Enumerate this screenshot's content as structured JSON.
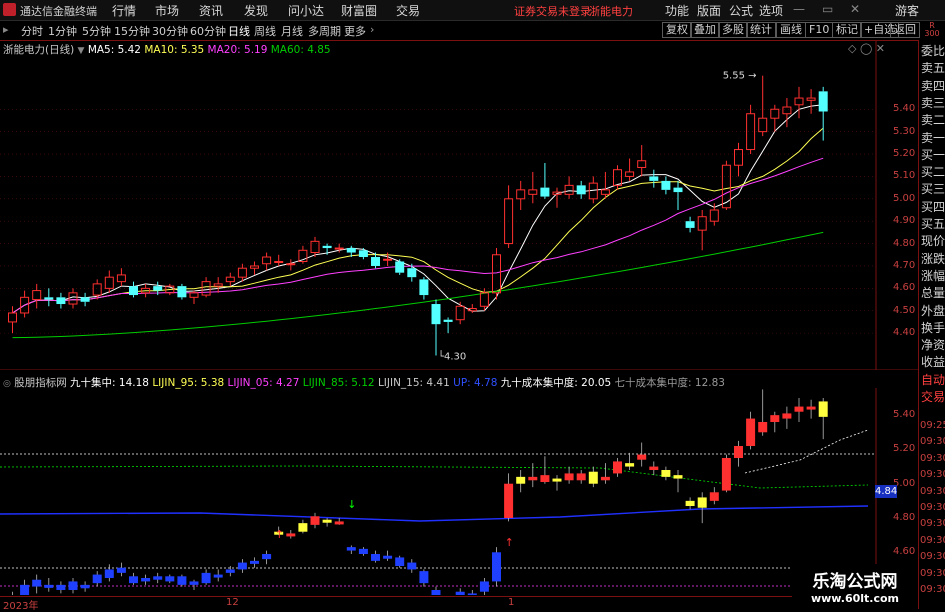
{
  "app": {
    "title": "通达信金融终端"
  },
  "menu": {
    "items": [
      "行情",
      "市场",
      "资讯",
      "发现",
      "问小达",
      "财富圈",
      "交易"
    ],
    "alert": "证券交易未登录",
    "stock_name": "浙能电力",
    "right_items": [
      "功能",
      "版面",
      "公式",
      "选项"
    ],
    "guest": "游客"
  },
  "toolbar": {
    "periods": [
      "分时",
      "1分钟",
      "5分钟",
      "15分钟",
      "30分钟",
      "60分钟",
      "日线",
      "周线",
      "月线",
      "多周期",
      "更多"
    ],
    "active_period": "日线",
    "right_buttons": [
      "复权",
      "叠加",
      "多股",
      "统计",
      "画线",
      "F10",
      "标记",
      "+自选",
      "返回"
    ]
  },
  "main_legend": {
    "title": "浙能电力(日线)",
    "ma5": "MA5: 5.42",
    "ma10": "MA10: 5.35",
    "ma20": "MA20: 5.19",
    "ma60": "MA60: 4.85",
    "high_label": "5.55",
    "low_label": "4.30"
  },
  "sub_legend": {
    "name": "股朋指标网",
    "jz90": "九十集中: 14.18",
    "lj95": "LIJIN_95: 5.38",
    "lj05": "LIJIN_05: 4.27",
    "lj85": "LIJIN_85: 5.12",
    "lj15": "LIJIN_15: 4.41",
    "up": "UP: 4.78",
    "cb90": "九十成本集中度: 20.05",
    "cb70": "七十成本集中度: 12.83"
  },
  "price_axis": [
    "5.40",
    "5.30",
    "5.20",
    "5.10",
    "5.00",
    "4.90",
    "4.80",
    "4.70",
    "4.60",
    "4.50",
    "4.40"
  ],
  "sub_axis": [
    "5.40",
    "5.20",
    "5.00",
    "4.80",
    "4.60"
  ],
  "sub_marker": "4.84",
  "sub_times": [
    "09:25",
    "09:30",
    "09:30",
    "09:30",
    "09:30",
    "09:30",
    "09:30",
    "09:30",
    "09:30",
    "09:30",
    "09:30"
  ],
  "date_axis": [
    "2023年",
    "12",
    "1"
  ],
  "right_column": [
    "委比",
    "卖五",
    "卖四",
    "卖三",
    "卖二",
    "卖一",
    "买一",
    "买二",
    "买三",
    "买四",
    "买五",
    "现价",
    "涨跌",
    "涨幅",
    "总量",
    "外盘",
    "换手",
    "净资",
    "收益",
    "自动",
    "交易"
  ],
  "corner": {
    "r": "R",
    "num": "300"
  },
  "watermark": {
    "line1": "乐淘公式网",
    "line2": "www.60lt.com"
  },
  "colors": {
    "up": "#ff3030",
    "down": "#54ffff",
    "ma5": "#ffffff",
    "ma10": "#ffff55",
    "ma20": "#ff40ff",
    "ma60": "#00cc00"
  },
  "chart_data": {
    "type": "candlestick",
    "title": "浙能电力(日线)",
    "candles": [
      {
        "o": 4.45,
        "h": 4.52,
        "l": 4.4,
        "c": 4.49
      },
      {
        "o": 4.49,
        "h": 4.59,
        "l": 4.47,
        "c": 4.56
      },
      {
        "o": 4.55,
        "h": 4.62,
        "l": 4.51,
        "c": 4.59
      },
      {
        "o": 4.56,
        "h": 4.6,
        "l": 4.52,
        "c": 4.55
      },
      {
        "o": 4.56,
        "h": 4.58,
        "l": 4.51,
        "c": 4.53
      },
      {
        "o": 4.53,
        "h": 4.6,
        "l": 4.51,
        "c": 4.58
      },
      {
        "o": 4.56,
        "h": 4.58,
        "l": 4.52,
        "c": 4.54
      },
      {
        "o": 4.57,
        "h": 4.64,
        "l": 4.55,
        "c": 4.62
      },
      {
        "o": 4.6,
        "h": 4.68,
        "l": 4.58,
        "c": 4.65
      },
      {
        "o": 4.63,
        "h": 4.69,
        "l": 4.61,
        "c": 4.66
      },
      {
        "o": 4.61,
        "h": 4.63,
        "l": 4.56,
        "c": 4.57
      },
      {
        "o": 4.58,
        "h": 4.62,
        "l": 4.56,
        "c": 4.6
      },
      {
        "o": 4.61,
        "h": 4.63,
        "l": 4.57,
        "c": 4.59
      },
      {
        "o": 4.58,
        "h": 4.62,
        "l": 4.57,
        "c": 4.61
      },
      {
        "o": 4.61,
        "h": 4.62,
        "l": 4.55,
        "c": 4.56
      },
      {
        "o": 4.56,
        "h": 4.59,
        "l": 4.53,
        "c": 4.58
      },
      {
        "o": 4.57,
        "h": 4.65,
        "l": 4.56,
        "c": 4.63
      },
      {
        "o": 4.61,
        "h": 4.65,
        "l": 4.58,
        "c": 4.62
      },
      {
        "o": 4.63,
        "h": 4.67,
        "l": 4.61,
        "c": 4.65
      },
      {
        "o": 4.65,
        "h": 4.71,
        "l": 4.63,
        "c": 4.69
      },
      {
        "o": 4.69,
        "h": 4.72,
        "l": 4.66,
        "c": 4.7
      },
      {
        "o": 4.71,
        "h": 4.76,
        "l": 4.68,
        "c": 4.74
      },
      {
        "o": 4.72,
        "h": 4.75,
        "l": 4.7,
        "c": 4.72
      },
      {
        "o": 4.71,
        "h": 4.73,
        "l": 4.68,
        "c": 4.71
      },
      {
        "o": 4.72,
        "h": 4.79,
        "l": 4.71,
        "c": 4.77
      },
      {
        "o": 4.76,
        "h": 4.83,
        "l": 4.74,
        "c": 4.81
      },
      {
        "o": 4.79,
        "h": 4.8,
        "l": 4.75,
        "c": 4.78
      },
      {
        "o": 4.78,
        "h": 4.8,
        "l": 4.76,
        "c": 4.78
      },
      {
        "o": 4.78,
        "h": 4.79,
        "l": 4.74,
        "c": 4.76
      },
      {
        "o": 4.77,
        "h": 4.78,
        "l": 4.73,
        "c": 4.74
      },
      {
        "o": 4.74,
        "h": 4.76,
        "l": 4.69,
        "c": 4.7
      },
      {
        "o": 4.73,
        "h": 4.76,
        "l": 4.7,
        "c": 4.73
      },
      {
        "o": 4.72,
        "h": 4.73,
        "l": 4.66,
        "c": 4.67
      },
      {
        "o": 4.69,
        "h": 4.71,
        "l": 4.63,
        "c": 4.65
      },
      {
        "o": 4.64,
        "h": 4.65,
        "l": 4.55,
        "c": 4.57
      },
      {
        "o": 4.53,
        "h": 4.55,
        "l": 4.3,
        "c": 4.44
      },
      {
        "o": 4.46,
        "h": 4.47,
        "l": 4.4,
        "c": 4.45
      },
      {
        "o": 4.46,
        "h": 4.54,
        "l": 4.44,
        "c": 4.52
      },
      {
        "o": 4.5,
        "h": 4.53,
        "l": 4.49,
        "c": 4.51
      },
      {
        "o": 4.52,
        "h": 4.6,
        "l": 4.5,
        "c": 4.58
      },
      {
        "o": 4.58,
        "h": 4.78,
        "l": 4.55,
        "c": 4.75
      },
      {
        "o": 4.8,
        "h": 5.06,
        "l": 4.78,
        "c": 5.0
      },
      {
        "o": 5.0,
        "h": 5.08,
        "l": 4.95,
        "c": 5.04
      },
      {
        "o": 5.02,
        "h": 5.12,
        "l": 4.98,
        "c": 5.04
      },
      {
        "o": 5.05,
        "h": 5.16,
        "l": 5.0,
        "c": 5.01
      },
      {
        "o": 5.02,
        "h": 5.05,
        "l": 4.96,
        "c": 5.03
      },
      {
        "o": 5.02,
        "h": 5.1,
        "l": 5.0,
        "c": 5.06
      },
      {
        "o": 5.06,
        "h": 5.08,
        "l": 5.0,
        "c": 5.02
      },
      {
        "o": 5.0,
        "h": 5.1,
        "l": 4.98,
        "c": 5.07
      },
      {
        "o": 5.02,
        "h": 5.12,
        "l": 5.0,
        "c": 5.04
      },
      {
        "o": 5.06,
        "h": 5.15,
        "l": 5.04,
        "c": 5.13
      },
      {
        "o": 5.1,
        "h": 5.18,
        "l": 5.08,
        "c": 5.12
      },
      {
        "o": 5.14,
        "h": 5.24,
        "l": 5.1,
        "c": 5.17
      },
      {
        "o": 5.1,
        "h": 5.13,
        "l": 5.05,
        "c": 5.08
      },
      {
        "o": 5.08,
        "h": 5.1,
        "l": 5.02,
        "c": 5.04
      },
      {
        "o": 5.05,
        "h": 5.08,
        "l": 4.95,
        "c": 5.03
      },
      {
        "o": 4.9,
        "h": 4.92,
        "l": 4.85,
        "c": 4.87
      },
      {
        "o": 4.86,
        "h": 4.95,
        "l": 4.77,
        "c": 4.92
      },
      {
        "o": 4.9,
        "h": 4.98,
        "l": 4.88,
        "c": 4.95
      },
      {
        "o": 4.96,
        "h": 5.17,
        "l": 4.95,
        "c": 5.15
      },
      {
        "o": 5.15,
        "h": 5.25,
        "l": 5.1,
        "c": 5.22
      },
      {
        "o": 5.22,
        "h": 5.42,
        "l": 5.2,
        "c": 5.38
      },
      {
        "o": 5.3,
        "h": 5.55,
        "l": 5.28,
        "c": 5.36
      },
      {
        "o": 5.36,
        "h": 5.42,
        "l": 5.3,
        "c": 5.4
      },
      {
        "o": 5.38,
        "h": 5.45,
        "l": 5.32,
        "c": 5.41
      },
      {
        "o": 5.42,
        "h": 5.5,
        "l": 5.36,
        "c": 5.45
      },
      {
        "o": 5.44,
        "h": 5.49,
        "l": 5.38,
        "c": 5.45
      },
      {
        "o": 5.48,
        "h": 5.5,
        "l": 5.26,
        "c": 5.39
      }
    ],
    "ma5_last": 5.42,
    "ma10_last": 5.35,
    "ma20_last": 5.19,
    "ma60_last": 4.85,
    "ylim": [
      4.28,
      5.62
    ]
  }
}
